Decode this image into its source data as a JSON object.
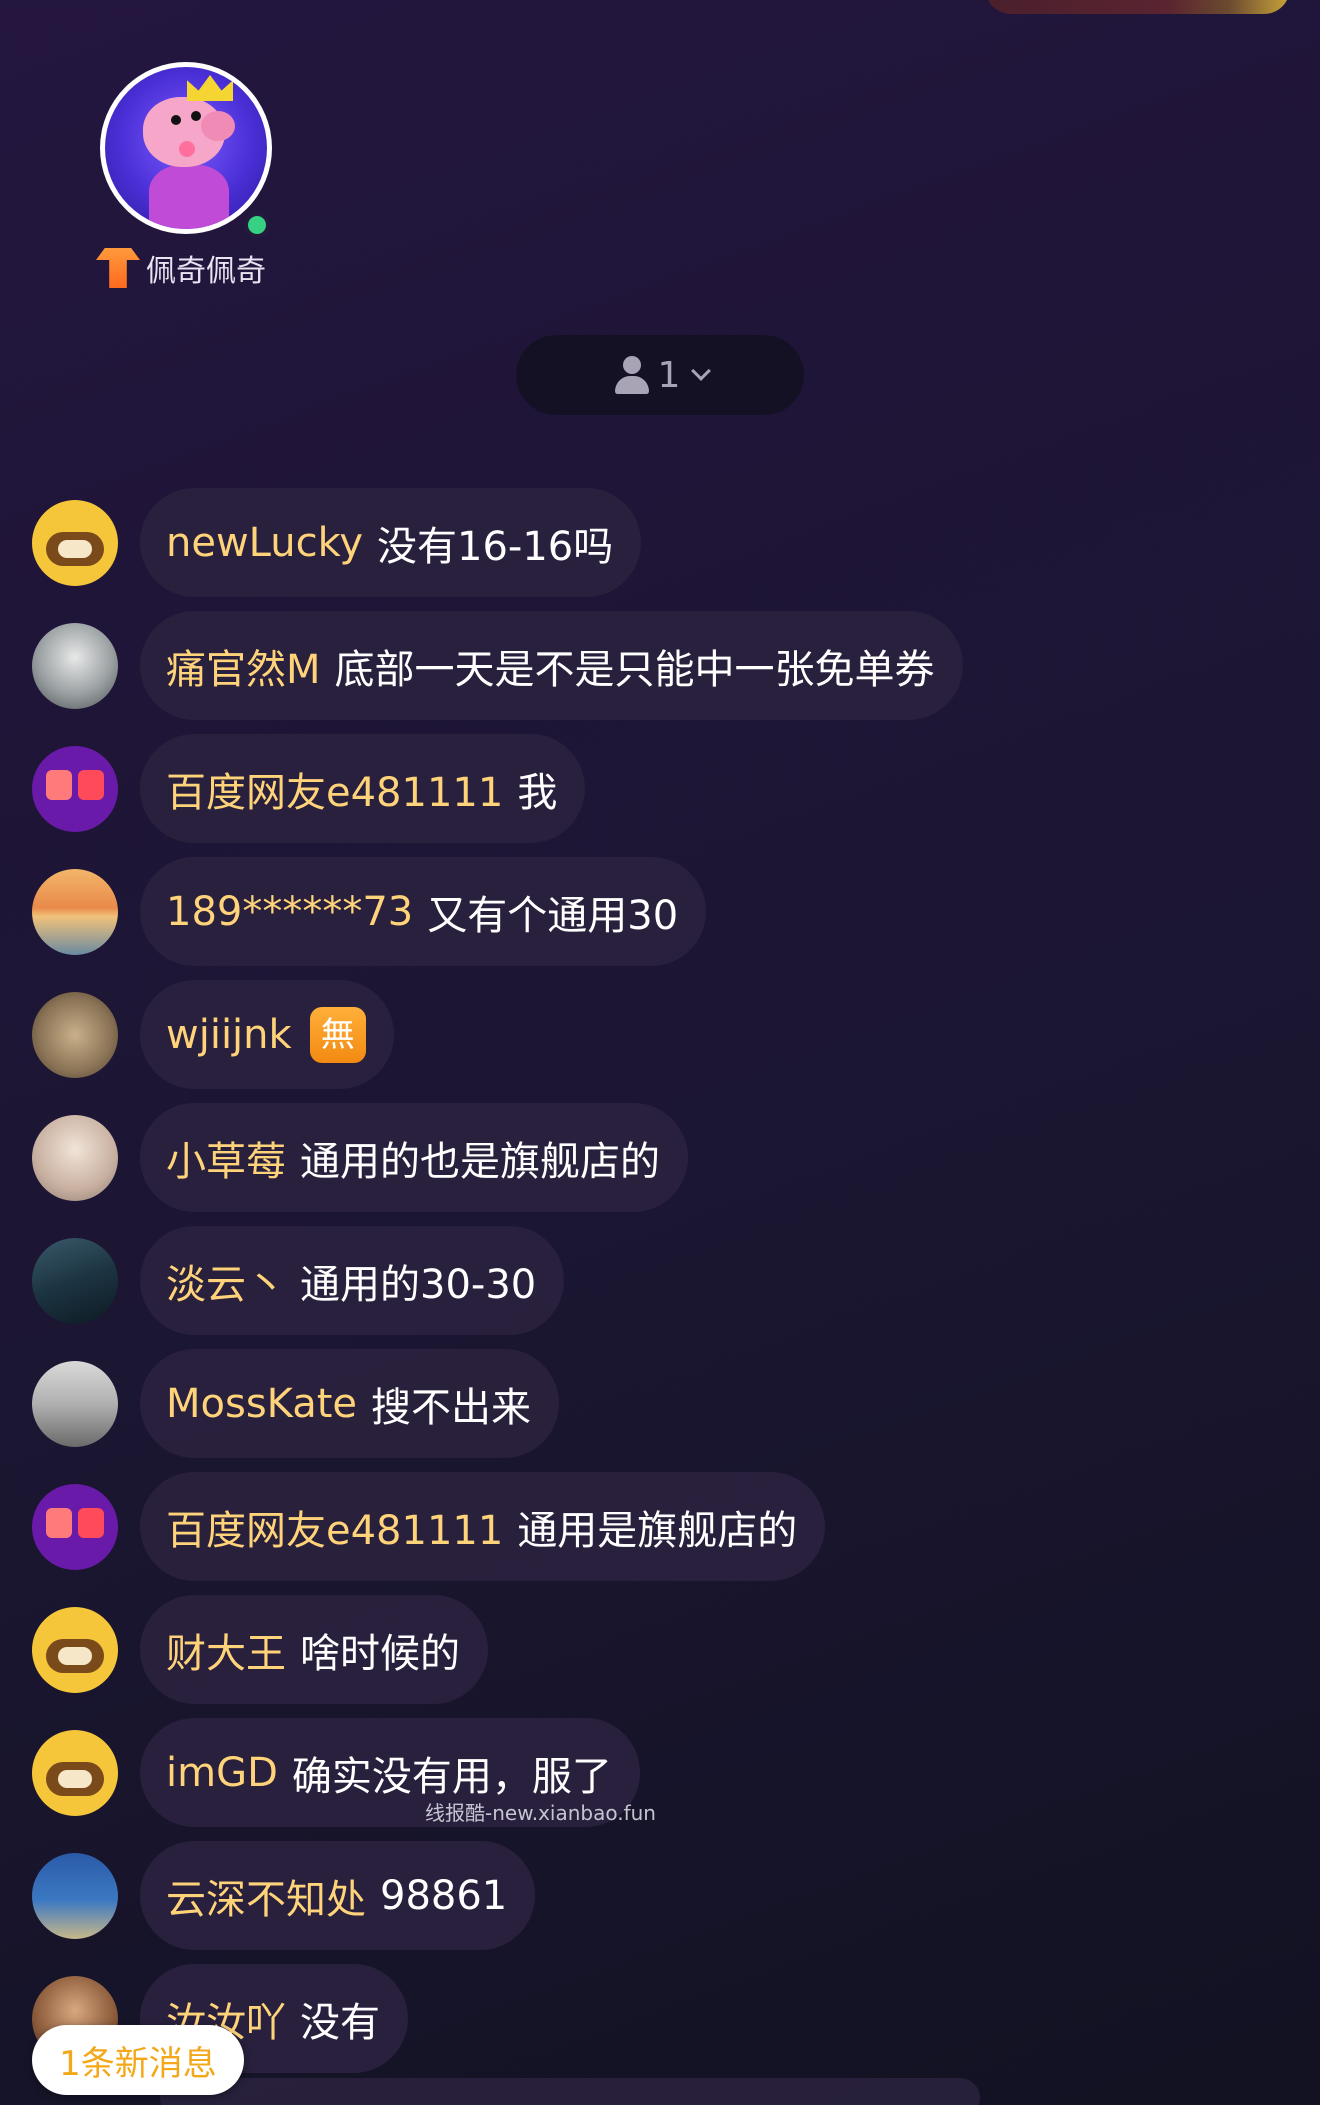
{
  "host": {
    "name": "佩奇佩奇",
    "avatar_icon": "peppa-pig-avatar",
    "online": true
  },
  "viewers": {
    "count": "1"
  },
  "messages": [
    {
      "user": "newLucky",
      "text": "没有16-16吗",
      "avatar": "raccoon-avatar"
    },
    {
      "user": "痛官然M",
      "text": "底部一天是不是只能中一张免单券",
      "avatar": "photo-avatar"
    },
    {
      "user": "百度网友e481111",
      "text": "我",
      "avatar": "app-avatar"
    },
    {
      "user": "189******73",
      "text": "又有个通用30",
      "avatar": "sunset-avatar"
    },
    {
      "user": "wjiijnk",
      "text": "",
      "avatar": "cat-avatar",
      "emoji": "無"
    },
    {
      "user": "小草莓",
      "text": "通用的也是旗舰店的",
      "avatar": "girl-avatar"
    },
    {
      "user": "淡云丶",
      "text": "通用的30-30",
      "avatar": "mountain-avatar"
    },
    {
      "user": "MossKate",
      "text": "搜不出来",
      "avatar": "tank-avatar"
    },
    {
      "user": "百度网友e481111",
      "text": "通用是旗舰店的",
      "avatar": "app-avatar"
    },
    {
      "user": "财大王",
      "text": "啥时候的",
      "avatar": "raccoon-avatar"
    },
    {
      "user": "imGD",
      "text": "确实没有用，服了",
      "avatar": "raccoon-avatar"
    },
    {
      "user": "云深不知处",
      "text": "98861",
      "avatar": "beach-avatar"
    },
    {
      "user": "汝汝吖",
      "text": "没有",
      "avatar": "woman-avatar"
    }
  ],
  "watermark": "线报酷-new.xianbao.fun",
  "new_message_button": "1条新消息"
}
